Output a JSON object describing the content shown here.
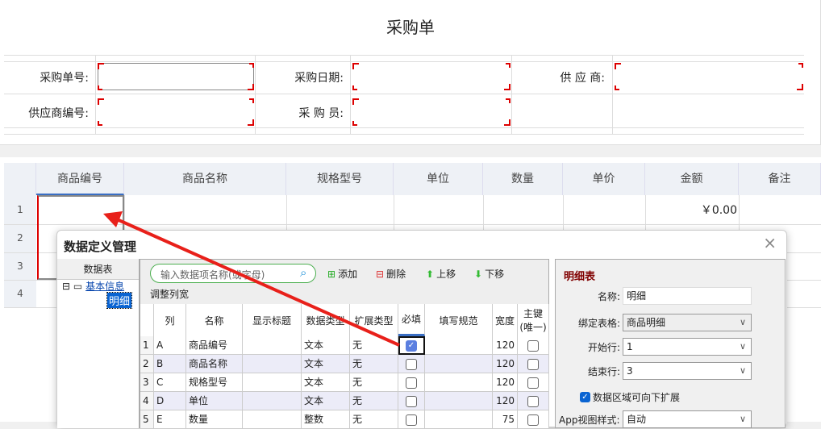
{
  "form": {
    "title": "采购单",
    "fields": [
      {
        "label": "采购单号:"
      },
      {
        "label": "采购日期:"
      },
      {
        "label": "供 应 商:"
      },
      {
        "label": "供应商编号:"
      },
      {
        "label": "采 购 员:"
      }
    ]
  },
  "detail": {
    "headers": [
      "商品编号",
      "商品名称",
      "规格型号",
      "单位",
      "数量",
      "单价",
      "金额",
      "备注"
    ],
    "row_numbers": [
      "1",
      "2",
      "3",
      "4"
    ],
    "amount": "￥0.00"
  },
  "dialog": {
    "title": "数据定义管理",
    "left": {
      "header": "数据表",
      "tree_root": "基本信息",
      "tree_child": "明细"
    },
    "toolbar": {
      "search_placeholder": "输入数据项名称(或字母)",
      "add": "添加",
      "delete": "删除",
      "up": "上移",
      "down": "下移",
      "adjust": "调整列宽"
    },
    "grid": {
      "headers": [
        "列",
        "名称",
        "显示标题",
        "数据类型",
        "扩展类型",
        "必填",
        "填写规范",
        "宽度",
        "主键(唯一)"
      ],
      "rows": [
        {
          "n": "1",
          "col": "A",
          "name": "商品编号",
          "type": "文本",
          "ext": "无",
          "required": true,
          "width": "120"
        },
        {
          "n": "2",
          "col": "B",
          "name": "商品名称",
          "type": "文本",
          "ext": "无",
          "required": false,
          "width": "120"
        },
        {
          "n": "3",
          "col": "C",
          "name": "规格型号",
          "type": "文本",
          "ext": "无",
          "required": false,
          "width": "120"
        },
        {
          "n": "4",
          "col": "D",
          "name": "单位",
          "type": "文本",
          "ext": "无",
          "required": false,
          "width": "120"
        },
        {
          "n": "5",
          "col": "E",
          "name": "数量",
          "type": "整数",
          "ext": "无",
          "required": false,
          "width": "75"
        }
      ]
    },
    "right": {
      "section": "明细表",
      "name_label": "名称:",
      "name_value": "明细",
      "bind_label": "绑定表格:",
      "bind_value": "商品明细",
      "start_label": "开始行:",
      "start_value": "1",
      "end_label": "结束行:",
      "end_value": "3",
      "expand_label": "数据区域可向下扩展",
      "app_label": "App视图样式:",
      "app_value": "自动"
    }
  },
  "colors": {
    "accent": "#d00000",
    "select": "#0a64d2"
  }
}
